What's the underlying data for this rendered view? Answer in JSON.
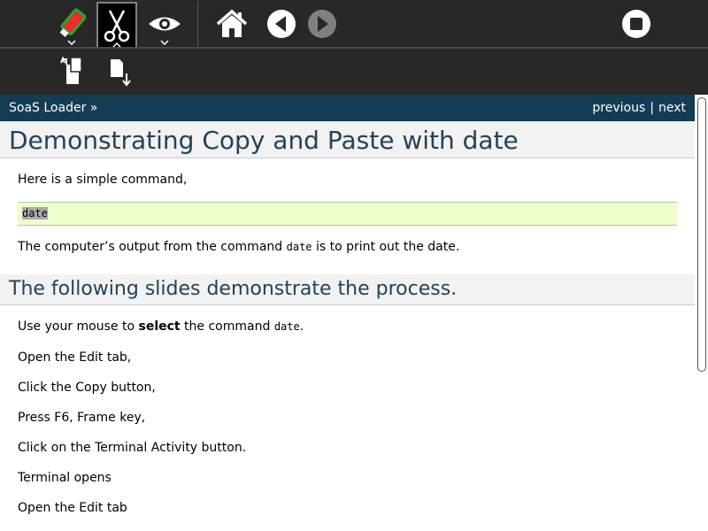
{
  "toolbar": {
    "buttons": [
      {
        "name": "activity-icon",
        "caret": true
      },
      {
        "name": "edit-icon",
        "caret": true,
        "active": true
      },
      {
        "name": "view-icon",
        "caret": true
      },
      {
        "name": "home-icon"
      },
      {
        "name": "back-icon"
      },
      {
        "name": "forward-icon"
      },
      {
        "name": "stop-icon"
      }
    ],
    "secondary": [
      {
        "name": "copy-icon"
      },
      {
        "name": "paste-icon"
      }
    ]
  },
  "nav": {
    "breadcrumb": "SoaS Loader »",
    "previous": "previous",
    "separator": "|",
    "next": "next"
  },
  "doc": {
    "title": "Demonstrating Copy and Paste with date",
    "intro": "Here is a simple command,",
    "code_line": "date",
    "output_before": "The computer’s output from the command ",
    "output_code": "date",
    "output_after": " is to print out the date.",
    "section_title": "The following slides demonstrate the process.",
    "step1_before": "Use your mouse to ",
    "step1_bold": "select",
    "step1_mid": " the command ",
    "step1_code": "date",
    "step1_after": ".",
    "steps": [
      "Open the Edit tab,",
      "Click the Copy button,",
      "Press F6, Frame key,",
      "Click on the Terminal Activity button.",
      "Terminal opens",
      "Open the Edit tab"
    ]
  },
  "colors": {
    "toolbar_bg": "#282828",
    "nav_bg": "#133c55",
    "heading": "#20435c",
    "code_bg": "#eeffcc"
  }
}
